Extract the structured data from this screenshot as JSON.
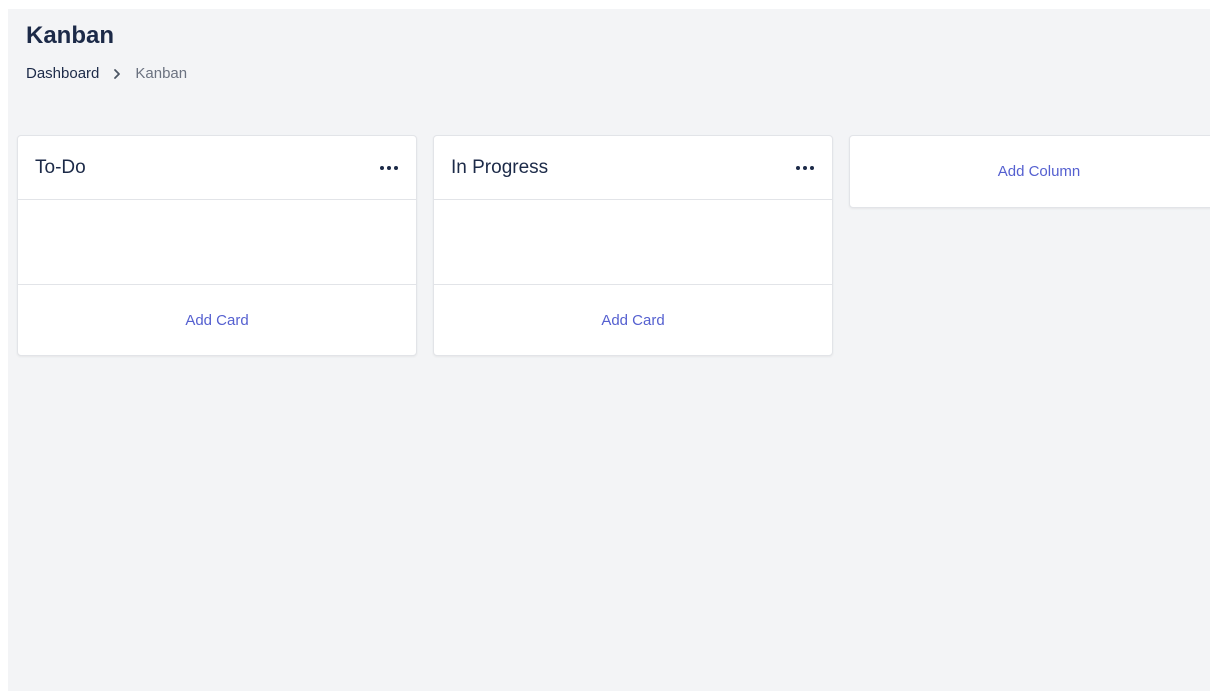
{
  "page": {
    "title": "Kanban"
  },
  "breadcrumb": {
    "items": [
      {
        "label": "Dashboard"
      },
      {
        "label": "Kanban"
      }
    ],
    "separator_icon": "chevron-right-icon"
  },
  "columns": [
    {
      "title": "To-Do",
      "menu_icon": "more-horizontal-icon",
      "cards": [],
      "add_card_label": "Add Card"
    },
    {
      "title": "In Progress",
      "menu_icon": "more-horizontal-icon",
      "cards": [],
      "add_card_label": "Add Card"
    }
  ],
  "add_column_label": "Add Column",
  "colors": {
    "background": "#f3f4f6",
    "heading": "#1c2a48",
    "accent": "#5560d0",
    "muted": "#6b7280",
    "border": "#e2e4e8"
  }
}
